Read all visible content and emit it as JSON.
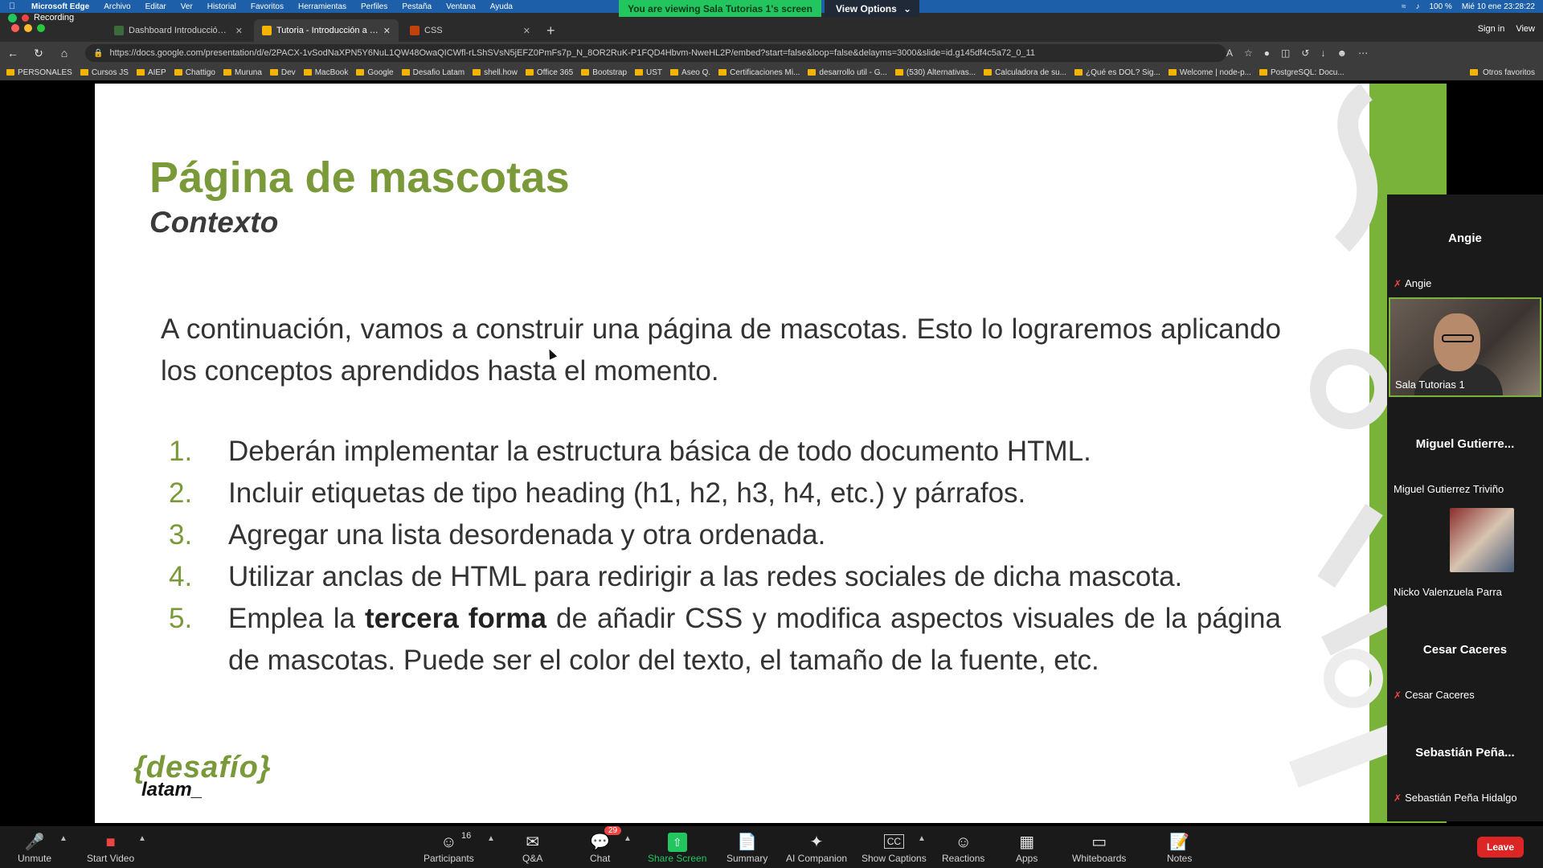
{
  "menubar": {
    "app": "Microsoft Edge",
    "items": [
      "Archivo",
      "Editar",
      "Ver",
      "Historial",
      "Favoritos",
      "Herramientas",
      "Perfiles",
      "Pestaña",
      "Ventana",
      "Ayuda"
    ],
    "battery": "100 %",
    "clock": "Mié 10 ene  23:28:22"
  },
  "zoom_header": {
    "banner": "You are viewing Sala Tutorias 1's screen",
    "view_options": "View Options",
    "sign_in": "Sign in",
    "view": "View",
    "recording": "Recording"
  },
  "browser": {
    "tabs": [
      {
        "title": "Dashboard Introducción al des",
        "active": false
      },
      {
        "title": "Tutoria - Introducción a CSS -",
        "active": true
      },
      {
        "title": "CSS",
        "active": false
      }
    ],
    "url": "https://docs.google.com/presentation/d/e/2PACX-1vSodNaXPN5Y6NuL1QW48OwaQICWfl-rLShSVsN5jEFZ0PmFs7p_N_8OR2RuK-P1FQD4Hbvm-NweHL2P/embed?start=false&loop=false&delayms=3000&slide=id.g145df4c5a72_0_11",
    "bookmarks": [
      "PERSONALES",
      "Cursos JS",
      "AIEP",
      "Chattigo",
      "Muruna",
      "Dev",
      "MacBook",
      "Google",
      "Desafio Latam",
      "shell.how",
      "Office 365",
      "Bootstrap",
      "UST",
      "Aseo Q.",
      "Certificaciones Mi...",
      "desarrollo util - G...",
      "(530) Alternativas...",
      "Calculadora de su...",
      "¿Qué es DOL? Sig...",
      "Welcome | node-p...",
      "PostgreSQL: Docu..."
    ],
    "bookmarks_other": "Otros favoritos"
  },
  "slide": {
    "title": "Página de mascotas",
    "subtitle": "Contexto",
    "intro": "A continuación, vamos a construir una página de mascotas. Esto lo lograremos aplicando los conceptos aprendidos hasta el momento.",
    "items": [
      {
        "num": "1.",
        "text": "Deberán implementar la estructura básica de todo documento HTML."
      },
      {
        "num": "2.",
        "text": "Incluir etiquetas de tipo heading (h1, h2, h3, h4, etc.) y párrafos."
      },
      {
        "num": "3.",
        "text": "Agregar una lista desordenada y otra ordenada."
      },
      {
        "num": "4.",
        "text": "Utilizar anclas de HTML para redirigir a las redes sociales de dicha mascota."
      },
      {
        "num": "5.",
        "pre": "Emplea la ",
        "bold": "tercera forma",
        "post": " de añadir CSS y modifica aspectos visuales de la página de mascotas. Puede ser el color del texto, el tamaño de la fuente, etc."
      }
    ],
    "logo_top": "{desafío}",
    "logo_bottom": "latam_"
  },
  "participants": [
    {
      "big": "Angie",
      "small": "Angie",
      "muted": true
    },
    {
      "big": "",
      "small": "Sala Tutorias 1",
      "muted": false
    },
    {
      "big": "Miguel  Gutierre...",
      "small": "Miguel Gutierrez Triviño",
      "muted": false
    },
    {
      "big": "",
      "small": "Nicko Valenzuela Parra",
      "muted": false
    },
    {
      "big": "Cesar Caceres",
      "small": "Cesar Caceres",
      "muted": true
    },
    {
      "big": "Sebastián  Peña...",
      "small": "Sebastián Peña Hidalgo",
      "muted": true
    }
  ],
  "toolbar": {
    "unmute": "Unmute",
    "start_video": "Start Video",
    "participants": "Participants",
    "participants_count": "16",
    "qa": "Q&A",
    "chat": "Chat",
    "chat_badge": "29",
    "share": "Share Screen",
    "summary": "Summary",
    "ai": "AI Companion",
    "captions": "Show Captions",
    "reactions": "Reactions",
    "apps": "Apps",
    "whiteboards": "Whiteboards",
    "notes": "Notes",
    "leave": "Leave"
  }
}
